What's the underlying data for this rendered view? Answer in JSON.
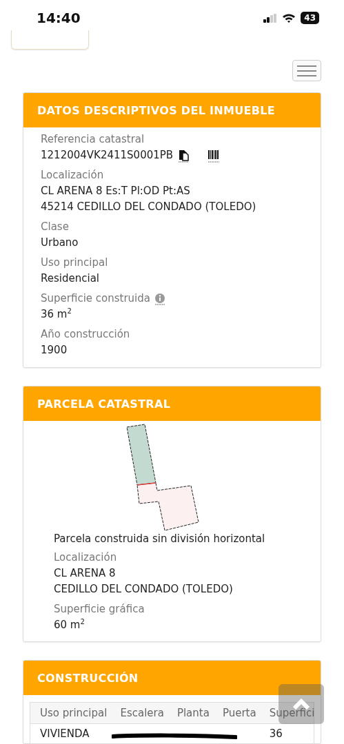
{
  "status_bar": {
    "time": "14:40",
    "battery": "43"
  },
  "sections": [
    {
      "kind": "fields",
      "title": "DATOS DESCRIPTIVOS DEL INMUEBLE",
      "fields": [
        {
          "label": "Referencia catastral",
          "kind": "reference",
          "lines": [
            "1212004VK2411S0001PB"
          ]
        },
        {
          "label": "Localización",
          "lines": [
            "CL ARENA 8 Es:T Pl:OD Pt:AS",
            "45214 CEDILLO DEL CONDADO (TOLEDO)"
          ]
        },
        {
          "label": "Clase",
          "lines": [
            "Urbano"
          ]
        },
        {
          "label": "Uso principal",
          "lines": [
            "Residencial"
          ]
        },
        {
          "label": "Superficie construida",
          "info": true,
          "lines": [
            "36 m$^{2}$"
          ]
        },
        {
          "label": "Año construcción",
          "lines": [
            "1900"
          ]
        }
      ]
    },
    {
      "kind": "parcel",
      "title": "PARCELA CATASTRAL",
      "caption": "Parcela construida sin división horizontal",
      "fields": [
        {
          "label": "Localización",
          "lines": [
            "CL ARENA 8",
            "CEDILLO DEL CONDADO (TOLEDO)"
          ]
        },
        {
          "label": "Superficie gráfica",
          "lines": [
            "60 m$^{2}$"
          ]
        }
      ]
    },
    {
      "kind": "table",
      "title": "CONSTRUCCIÓN",
      "columns": [
        "Uso principal",
        "Escalera",
        "Planta",
        "Puerta",
        "Superfici"
      ],
      "rows": [
        [
          "VIVIENDA",
          null,
          null,
          null,
          "36"
        ]
      ]
    }
  ]
}
